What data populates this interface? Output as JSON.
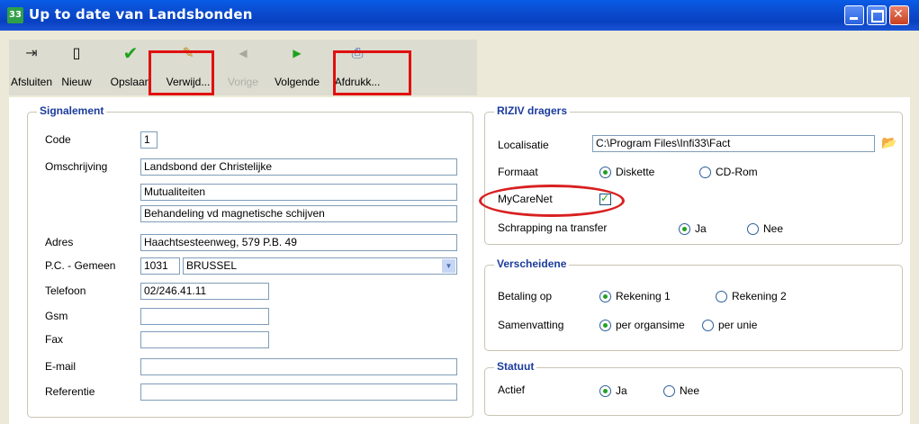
{
  "window": {
    "title": "Up to date van Landsbonden",
    "icon_text": "33"
  },
  "toolbar": {
    "buttons": [
      {
        "label": "Afsluiten",
        "icon": "exit-door-icon",
        "glyph": "⇥",
        "color": "#333333"
      },
      {
        "label": "Nieuw",
        "icon": "new-document-icon",
        "glyph": "🗋",
        "color": "#000000"
      },
      {
        "label": "Opslaan",
        "icon": "checkmark-icon",
        "glyph": "✔",
        "color": "#1ea21e"
      },
      {
        "label": "Verwijd...",
        "icon": "eraser-icon",
        "glyph": "✎",
        "color": "#c08a20"
      },
      {
        "label": "Vorige",
        "icon": "arrow-left-icon",
        "glyph": "◀",
        "color": "#a0a0a0"
      },
      {
        "label": "Volgende",
        "icon": "arrow-right-icon",
        "glyph": "▶",
        "color": "#1ea21e"
      },
      {
        "label": "Afdrukk...",
        "icon": "printer-icon",
        "glyph": "⎙",
        "color": "#4a6cb0"
      }
    ]
  },
  "signalement": {
    "title": "Signalement",
    "code_label": "Code",
    "code_value": "1",
    "omschrijving_label": "Omschrijving",
    "omschrijving_lines": [
      "Landsbond der Christelijke",
      "Mutualiteiten",
      "Behandeling vd magnetische schijven"
    ],
    "adres_label": "Adres",
    "adres_value": "Haachtsesteenweg, 579 P.B. 49",
    "pc_label": "P.C. - Gemeen",
    "pc_value": "1031",
    "gemeente_value": "BRUSSEL",
    "telefoon_label": "Telefoon",
    "telefoon_value": "02/246.41.11",
    "gsm_label": "Gsm",
    "gsm_value": "",
    "fax_label": "Fax",
    "fax_value": "",
    "email_label": "E-mail",
    "email_value": "",
    "referentie_label": "Referentie",
    "referentie_value": ""
  },
  "riziv": {
    "title": "RIZIV dragers",
    "localisatie_label": "Localisatie",
    "localisatie_value": "C:\\Program Files\\Infi33\\Fact",
    "formaat_label": "Formaat",
    "formaat_options": [
      "Diskette",
      "CD-Rom"
    ],
    "formaat_selected": "Diskette",
    "mycarenet_label": "MyCareNet",
    "mycarenet_checked": true,
    "schrapping_label": "Schrapping na transfer",
    "schrapping_options": [
      "Ja",
      "Nee"
    ],
    "schrapping_selected": "Ja"
  },
  "verscheidene": {
    "title": "Verscheidene",
    "betaling_label": "Betaling op",
    "betaling_options": [
      "Rekening 1",
      "Rekening 2"
    ],
    "betaling_selected": "Rekening 1",
    "samenvatting_label": "Samenvatting",
    "samenvatting_options": [
      "per organsime",
      "per unie"
    ],
    "samenvatting_selected": "per organsime"
  },
  "statuut": {
    "title": "Statuut",
    "actief_label": "Actief",
    "actief_options": [
      "Ja",
      "Nee"
    ],
    "actief_selected": "Ja"
  }
}
